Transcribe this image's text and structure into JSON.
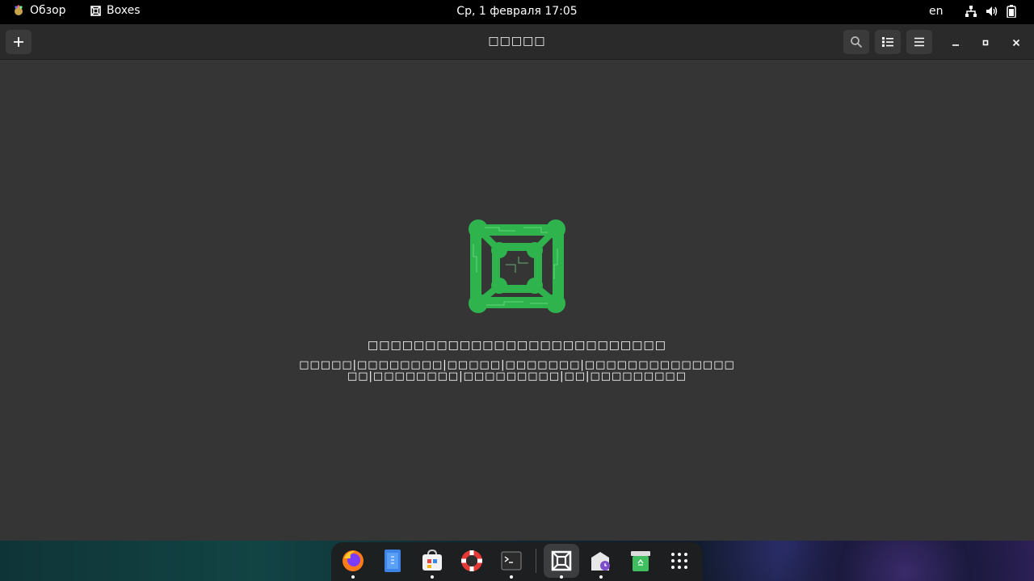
{
  "topbar": {
    "activities_label": "Обзор",
    "app_name": "Boxes",
    "clock": "Ср, 1 февраля  17:05",
    "language": "en"
  },
  "window": {
    "title": "□□□□□",
    "empty_title": "□□□□□□□□□□□□□□□□□□□□□□□□□□",
    "empty_description": "□□□□□|□□□□□□□□|□□□□□|□□□□□□□|□□□□□□□□□□□□□□□□|□□□□□□□□|□□□□□□□□□|□□|□□□□□□□□□",
    "colors": {
      "accent": "#33c653",
      "window_bg": "#353535",
      "headerbar_bg": "#2a2a2a"
    }
  },
  "dock": {
    "apps": [
      {
        "name": "firefox-icon",
        "running": true
      },
      {
        "name": "text-editor-icon",
        "running": false
      },
      {
        "name": "software-icon",
        "running": true
      },
      {
        "name": "help-icon",
        "running": false
      },
      {
        "name": "terminal-icon",
        "running": true
      },
      {
        "name": "boxes-icon",
        "running": true
      },
      {
        "name": "backups-icon",
        "running": true
      },
      {
        "name": "trash-icon",
        "running": false
      },
      {
        "name": "app-grid-icon",
        "running": false
      }
    ]
  }
}
